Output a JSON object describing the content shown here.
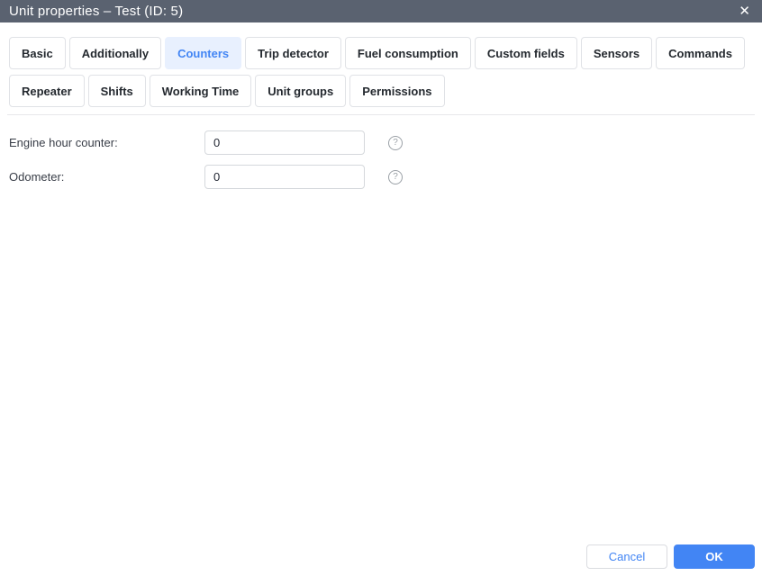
{
  "titlebar": {
    "title": "Unit properties – Test (ID: 5)",
    "close_glyph": "✕"
  },
  "tabs": [
    {
      "label": "Basic",
      "active": false
    },
    {
      "label": "Additionally",
      "active": false
    },
    {
      "label": "Counters",
      "active": true
    },
    {
      "label": "Trip detector",
      "active": false
    },
    {
      "label": "Fuel consumption",
      "active": false
    },
    {
      "label": "Custom fields",
      "active": false
    },
    {
      "label": "Sensors",
      "active": false
    },
    {
      "label": "Commands",
      "active": false
    },
    {
      "label": "Repeater",
      "active": false
    },
    {
      "label": "Shifts",
      "active": false
    },
    {
      "label": "Working Time",
      "active": false
    },
    {
      "label": "Unit groups",
      "active": false
    },
    {
      "label": "Permissions",
      "active": false
    }
  ],
  "form": {
    "fields": [
      {
        "label": "Engine hour counter:",
        "value": "0",
        "help_glyph": "?"
      },
      {
        "label": "Odometer:",
        "value": "0",
        "help_glyph": "?"
      }
    ]
  },
  "footer": {
    "cancel_label": "Cancel",
    "ok_label": "OK"
  },
  "colors": {
    "titlebar_bg": "#5a6270",
    "accent_blue": "#4285f4",
    "active_tab_bg": "#e8f0fe",
    "tab_border": "#e0e2e6",
    "icon_gray": "#9aa0a6"
  }
}
